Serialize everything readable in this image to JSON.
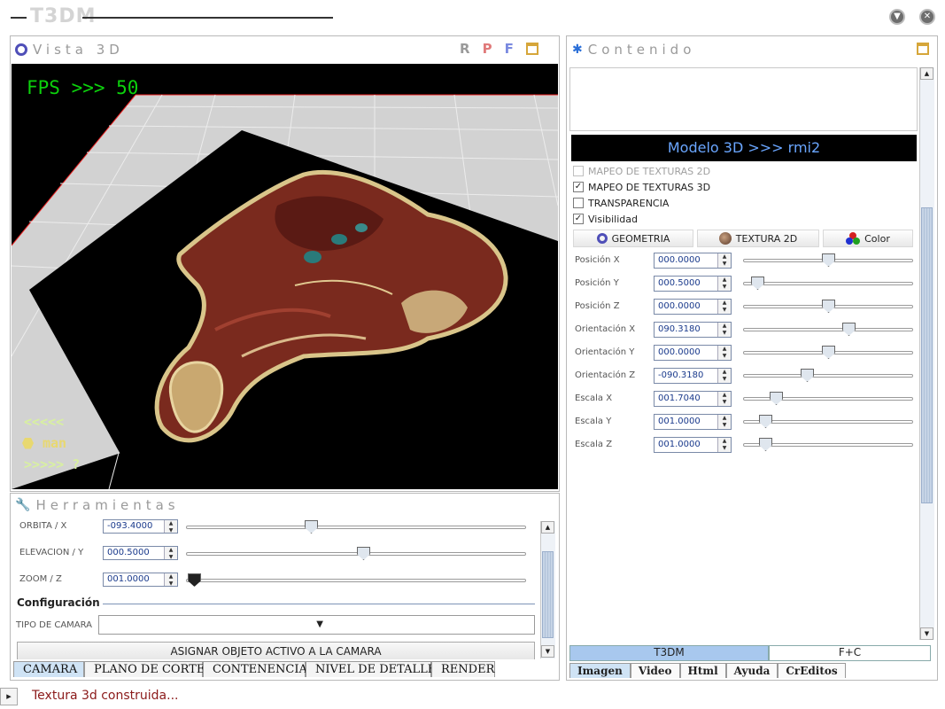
{
  "app": {
    "title": "T3DM"
  },
  "vista3d": {
    "title": "Vista 3D",
    "header_buttons": [
      {
        "label": "R",
        "color": "#9a9a9a"
      },
      {
        "label": "P",
        "color": "#e07a7a"
      },
      {
        "label": "F",
        "color": "#7a8ae0"
      }
    ],
    "fps_text": "FPS >>> 50",
    "nav_prev": "<<<<<",
    "nav_model": "man",
    "nav_next": ">>>>> ?"
  },
  "herramientas": {
    "title": "Herramientas",
    "rows": [
      {
        "label": "ORBITA / X",
        "value": "-093.4000",
        "fraction": 0.37
      },
      {
        "label": "ELEVACION / Y",
        "value": "000.5000",
        "fraction": 0.52
      },
      {
        "label": "ZOOM / Z",
        "value": "001.0000",
        "fraction": 0.02
      }
    ],
    "config_label": "Configuración",
    "camera_type_label": "TIPO DE CAMARA",
    "camera_type_value": "",
    "assign_button": "ASIGNAR OBJETO ACTIVO A LA CAMARA",
    "tabs": [
      "CAMARA",
      "PLANO DE CORTE",
      "CONTENENCIA",
      "NIVEL DE DETALLE",
      "RENDER"
    ],
    "active_tab": "CAMARA"
  },
  "contenido": {
    "title": "Contenido",
    "model_banner": "Modelo 3D >>> rmi2",
    "checkboxes": [
      {
        "label": "MAPEO DE TEXTURAS 2D",
        "checked": false,
        "disabled": true
      },
      {
        "label": "MAPEO DE TEXTURAS 3D",
        "checked": true,
        "disabled": false
      },
      {
        "label": "TRANSPARENCIA",
        "checked": false,
        "disabled": false
      },
      {
        "label": "Visibilidad",
        "checked": true,
        "disabled": false
      }
    ],
    "mode_buttons": [
      "GEOMETRIA",
      "TEXTURA 2D",
      "Color"
    ],
    "properties": [
      {
        "label": "Posición X",
        "value": "000.0000",
        "fraction": 0.5
      },
      {
        "label": "Posición Y",
        "value": "000.5000",
        "fraction": 0.05
      },
      {
        "label": "Posición Z",
        "value": "000.0000",
        "fraction": 0.5
      },
      {
        "label": "Orientación X",
        "value": "090.3180",
        "fraction": 0.63
      },
      {
        "label": "Orientación Y",
        "value": "000.0000",
        "fraction": 0.5
      },
      {
        "label": "Orientación Z",
        "value": "-090.3180",
        "fraction": 0.37
      },
      {
        "label": "Escala X",
        "value": "001.7040",
        "fraction": 0.17
      },
      {
        "label": "Escala Y",
        "value": "001.0000",
        "fraction": 0.1
      },
      {
        "label": "Escala Z",
        "value": "001.0000",
        "fraction": 0.1
      }
    ],
    "bottom_tabs": [
      "T3DM",
      "F+C"
    ],
    "menu_tabs": [
      "Imagen",
      "Video",
      "Html",
      "Ayuda",
      "CrEditos"
    ]
  },
  "status": {
    "message": "Textura 3d construida..."
  },
  "colors": {
    "fps_green": "#0cd10c",
    "banner_bg": "#000000",
    "banner_text": "#6aa6ff",
    "active_tab": "#cfe3f5",
    "status_text": "#8b1a1a"
  }
}
